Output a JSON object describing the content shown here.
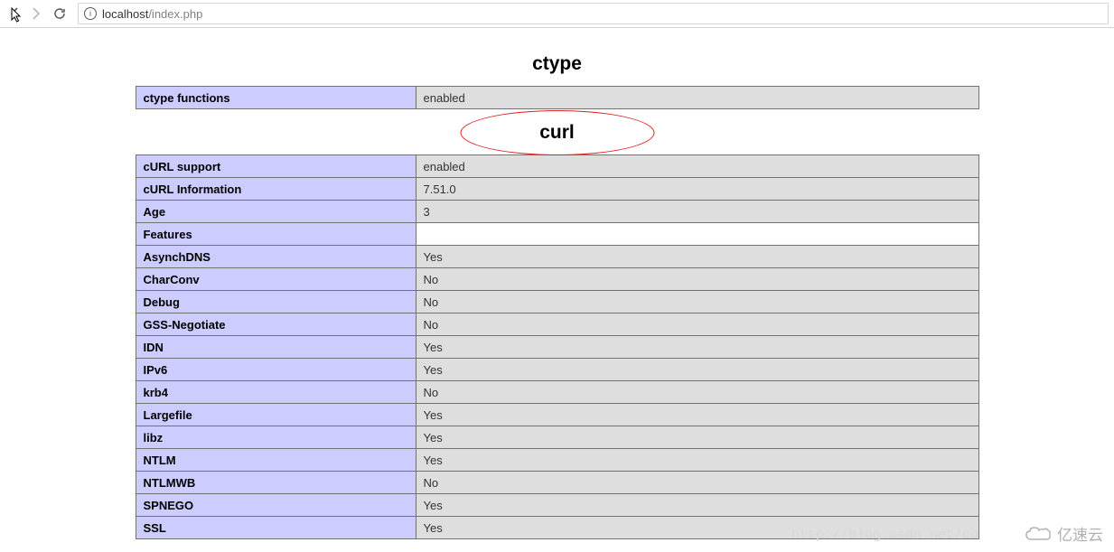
{
  "browser": {
    "url_host": "localhost",
    "url_path": "/index.php"
  },
  "sections": {
    "ctype": {
      "heading": "ctype",
      "rows": [
        {
          "k": "ctype functions",
          "v": "enabled"
        }
      ]
    },
    "curl": {
      "heading": "curl",
      "rows": [
        {
          "k": "cURL support",
          "v": "enabled"
        },
        {
          "k": "cURL Information",
          "v": "7.51.0"
        },
        {
          "k": "Age",
          "v": "3"
        },
        {
          "k": "Features",
          "v": "",
          "blank": true
        },
        {
          "k": "AsynchDNS",
          "v": "Yes"
        },
        {
          "k": "CharConv",
          "v": "No"
        },
        {
          "k": "Debug",
          "v": "No"
        },
        {
          "k": "GSS-Negotiate",
          "v": "No"
        },
        {
          "k": "IDN",
          "v": "Yes"
        },
        {
          "k": "IPv6",
          "v": "Yes"
        },
        {
          "k": "krb4",
          "v": "No"
        },
        {
          "k": "Largefile",
          "v": "Yes"
        },
        {
          "k": "libz",
          "v": "Yes"
        },
        {
          "k": "NTLM",
          "v": "Yes"
        },
        {
          "k": "NTLMWB",
          "v": "No"
        },
        {
          "k": "SPNEGO",
          "v": "Yes"
        },
        {
          "k": "SSL",
          "v": "Yes"
        }
      ]
    }
  },
  "watermark": {
    "url": "http://blog.csdn.net/co",
    "logo": "亿速云"
  }
}
